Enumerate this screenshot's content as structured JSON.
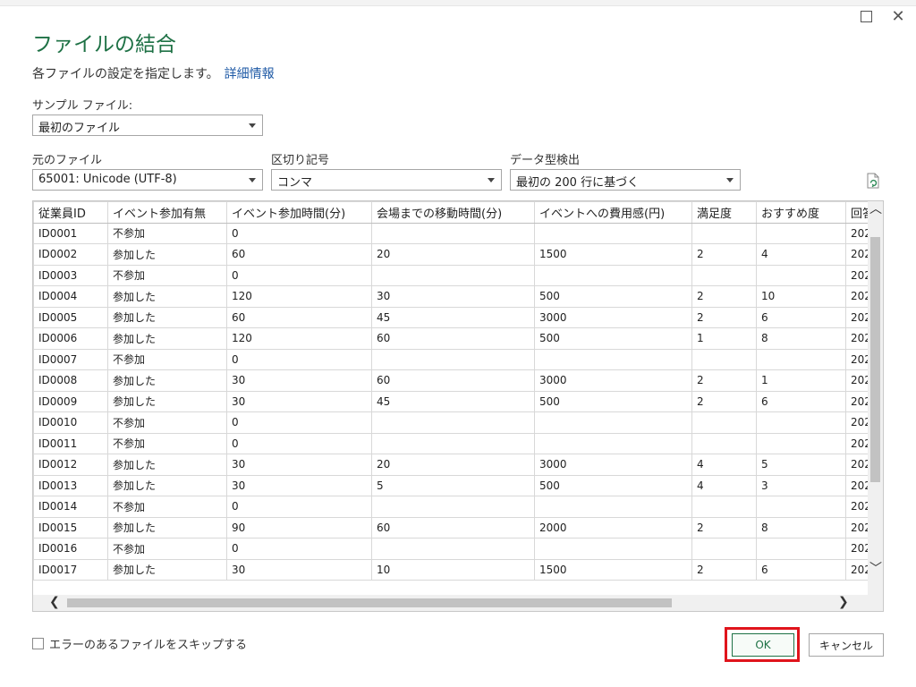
{
  "dialog": {
    "title": "ファイルの結合",
    "subtitle": "各ファイルの設定を指定します。",
    "learn_more": "詳細情報"
  },
  "sample_file": {
    "label": "サンプル ファイル:",
    "value": "最初のファイル"
  },
  "origin_file": {
    "label": "元のファイル",
    "value": "65001: Unicode (UTF-8)"
  },
  "delimiter": {
    "label": "区切り記号",
    "value": "コンマ"
  },
  "type_detection": {
    "label": "データ型検出",
    "value": "最初の 200 行に基づく"
  },
  "table": {
    "headers": [
      "従業員ID",
      "イベント参加有無",
      "イベント参加時間(分)",
      "会場までの移動時間(分)",
      "イベントへの費用感(円)",
      "満足度",
      "おすすめ度",
      "回答"
    ],
    "rows": [
      [
        "ID0001",
        "不参加",
        "0",
        "",
        "",
        "",
        "",
        "202"
      ],
      [
        "ID0002",
        "参加した",
        "60",
        "20",
        "1500",
        "2",
        "4",
        "202"
      ],
      [
        "ID0003",
        "不参加",
        "0",
        "",
        "",
        "",
        "",
        "202"
      ],
      [
        "ID0004",
        "参加した",
        "120",
        "30",
        "500",
        "2",
        "10",
        "202"
      ],
      [
        "ID0005",
        "参加した",
        "60",
        "45",
        "3000",
        "2",
        "6",
        "202"
      ],
      [
        "ID0006",
        "参加した",
        "120",
        "60",
        "500",
        "1",
        "8",
        "202"
      ],
      [
        "ID0007",
        "不参加",
        "0",
        "",
        "",
        "",
        "",
        "202"
      ],
      [
        "ID0008",
        "参加した",
        "30",
        "60",
        "3000",
        "2",
        "1",
        "202"
      ],
      [
        "ID0009",
        "参加した",
        "30",
        "45",
        "500",
        "2",
        "6",
        "202"
      ],
      [
        "ID0010",
        "不参加",
        "0",
        "",
        "",
        "",
        "",
        "202"
      ],
      [
        "ID0011",
        "不参加",
        "0",
        "",
        "",
        "",
        "",
        "202"
      ],
      [
        "ID0012",
        "参加した",
        "30",
        "20",
        "3000",
        "4",
        "5",
        "202"
      ],
      [
        "ID0013",
        "参加した",
        "30",
        "5",
        "500",
        "4",
        "3",
        "202"
      ],
      [
        "ID0014",
        "不参加",
        "0",
        "",
        "",
        "",
        "",
        "202"
      ],
      [
        "ID0015",
        "参加した",
        "90",
        "60",
        "2000",
        "2",
        "8",
        "202"
      ],
      [
        "ID0016",
        "不参加",
        "0",
        "",
        "",
        "",
        "",
        "202"
      ],
      [
        "ID0017",
        "参加した",
        "30",
        "10",
        "1500",
        "2",
        "6",
        "202"
      ]
    ]
  },
  "skip_errors": {
    "label": "エラーのあるファイルをスキップする"
  },
  "buttons": {
    "ok": "OK",
    "cancel": "キャンセル"
  },
  "colors": {
    "title": "#1e7145",
    "link": "#1f5aa6",
    "highlight": "#e0141c"
  }
}
